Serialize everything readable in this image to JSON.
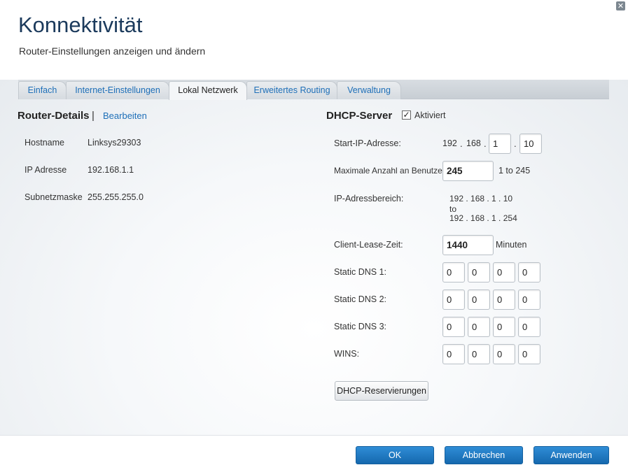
{
  "header": {
    "title": "Konnektivität",
    "subtitle": "Router-Einstellungen anzeigen und ändern",
    "close_symbol": "✕"
  },
  "tabs": [
    {
      "label": "Einfach",
      "active": false
    },
    {
      "label": "Internet-Einstellungen",
      "active": false
    },
    {
      "label": "Lokal Netzwerk",
      "active": true
    },
    {
      "label": "Erweitertes Routing",
      "active": false
    },
    {
      "label": "Verwaltung",
      "active": false
    }
  ],
  "router_details": {
    "title": "Router-Details",
    "separator": "|",
    "edit_link": "Bearbeiten",
    "rows": [
      {
        "label": "Hostname",
        "value": "Linksys29303"
      },
      {
        "label": "IP Adresse",
        "value": "192.168.1.1"
      },
      {
        "label": "Subnetzmaske",
        "value": "255.255.255.0"
      }
    ]
  },
  "dhcp": {
    "title": "DHCP-Server",
    "enabled_label": "Aktiviert",
    "enabled": true,
    "check_symbol": "✓",
    "start_ip": {
      "label": "Start-IP-Adresse:",
      "fixed1": "192",
      "fixed2": "168",
      "dot": ".",
      "octet3": "1",
      "octet4": "10"
    },
    "max_users": {
      "label": "Maximale Anzahl an Benutzern:",
      "value": "245",
      "range": "1 to 245"
    },
    "ip_range": {
      "label": "IP-Adressbereich:",
      "from": "192 . 168 . 1 . 10",
      "to_word": "to",
      "to": "192 . 168 . 1 . 254"
    },
    "lease": {
      "label": "Client-Lease-Zeit:",
      "value": "1440",
      "unit": "Minuten"
    },
    "dns1": {
      "label": "Static DNS 1:",
      "octets": [
        "0",
        "0",
        "0",
        "0"
      ]
    },
    "dns2": {
      "label": "Static DNS 2:",
      "octets": [
        "0",
        "0",
        "0",
        "0"
      ]
    },
    "dns3": {
      "label": "Static DNS 3:",
      "octets": [
        "0",
        "0",
        "0",
        "0"
      ]
    },
    "wins": {
      "label": "WINS:",
      "octets": [
        "0",
        "0",
        "0",
        "0"
      ]
    },
    "reservations_button": "DHCP-Reservierungen"
  },
  "footer": {
    "ok": "OK",
    "cancel": "Abbrechen",
    "apply": "Anwenden"
  },
  "colors": {
    "title": "#1b3a5c",
    "link": "#1e6fb8",
    "primary_button": "#1e78c2"
  }
}
